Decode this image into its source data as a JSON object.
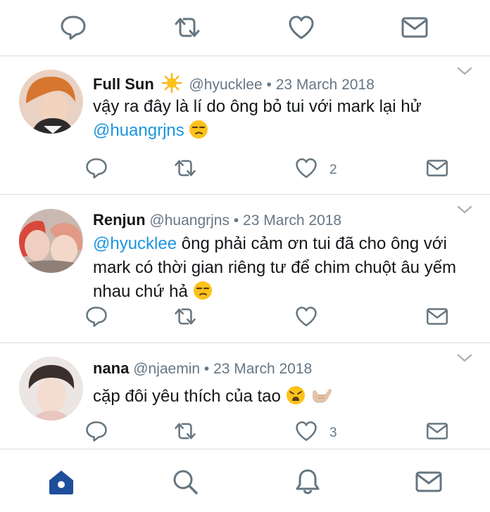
{
  "top_actions": {
    "icons": [
      "reply-icon",
      "retweet-icon",
      "like-icon",
      "message-icon"
    ]
  },
  "tweets": [
    {
      "name": "Full Sun",
      "name_emoji": "sun-emoji",
      "handle": "@hyucklee",
      "separator": "•",
      "date": "23 March 2018",
      "text_line1": "vậy ra đây là lí do ông bỏ tui với mark lại hử",
      "mention": "@huangrjns",
      "emojis": [
        "unamused-face-emoji"
      ],
      "like_count": "2"
    },
    {
      "name": "Renjun",
      "handle": "@huangrjns",
      "separator": "•",
      "date": "23 March 2018",
      "mention": "@hyucklee",
      "text": " ông phải cảm ơn tui đã cho ông với mark có thời gian riêng tư để chim chuột âu yếm nhau chứ hả",
      "emojis": [
        "unamused-face-emoji"
      ],
      "like_count": ""
    },
    {
      "name": "nana",
      "handle": "@njaemin",
      "separator": "•",
      "date": "23 March 2018",
      "text": "cặp đôi yêu thích của tao",
      "emojis": [
        "weary-face-emoji",
        "call-me-hand-emoji"
      ],
      "like_count": "3"
    }
  ],
  "bottom_nav": {
    "items": [
      "home-icon",
      "search-icon",
      "notifications-icon",
      "messages-icon"
    ],
    "active": "home-icon"
  },
  "colors": {
    "accent": "#1b95e0",
    "nav_active": "#1f4e9a",
    "icon": "#66757f",
    "divider": "#d8dde1",
    "muted_text": "#657786"
  }
}
